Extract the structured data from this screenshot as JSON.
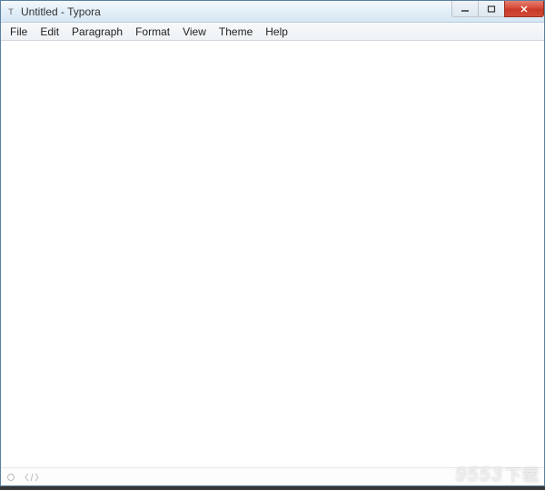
{
  "title": "Untitled - Typora",
  "app_icon_letter": "T",
  "menu": {
    "file": "File",
    "edit": "Edit",
    "paragraph": "Paragraph",
    "format": "Format",
    "view": "View",
    "theme": "Theme",
    "help": "Help"
  },
  "editor": {
    "content": ""
  },
  "watermark": {
    "brand": "9553",
    "suffix": "下载"
  }
}
